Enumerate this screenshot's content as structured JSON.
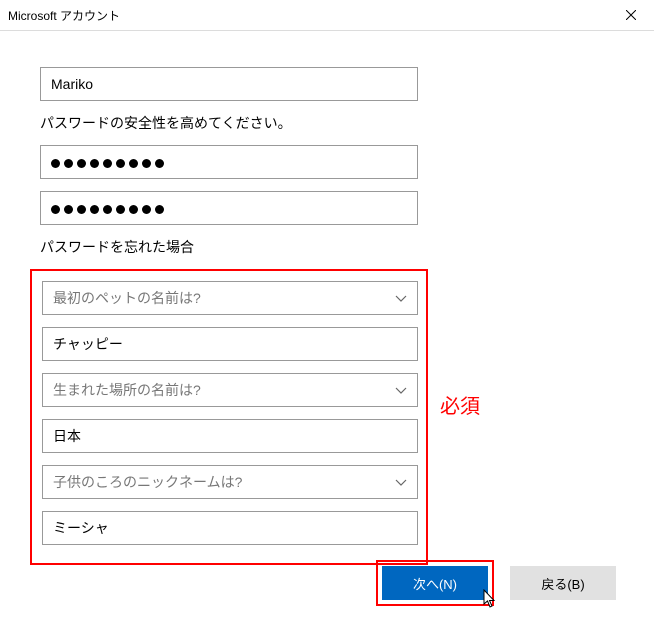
{
  "titlebar": {
    "title": "Microsoft アカウント"
  },
  "form": {
    "username": "Mariko",
    "password_heading": "パスワードの安全性を高めてください。",
    "password_dots": 9,
    "password_confirm_dots": 9,
    "forgot_heading": "パスワードを忘れた場合",
    "q1": {
      "label": "最初のペットの名前は?",
      "answer": "チャッピー"
    },
    "q2": {
      "label": "生まれた場所の名前は?",
      "answer": "日本"
    },
    "q3": {
      "label": "子供のころのニックネームは?",
      "answer": "ミーシャ"
    }
  },
  "annotation": {
    "required": "必須"
  },
  "buttons": {
    "next": "次へ(N)",
    "back": "戻る(B)"
  }
}
